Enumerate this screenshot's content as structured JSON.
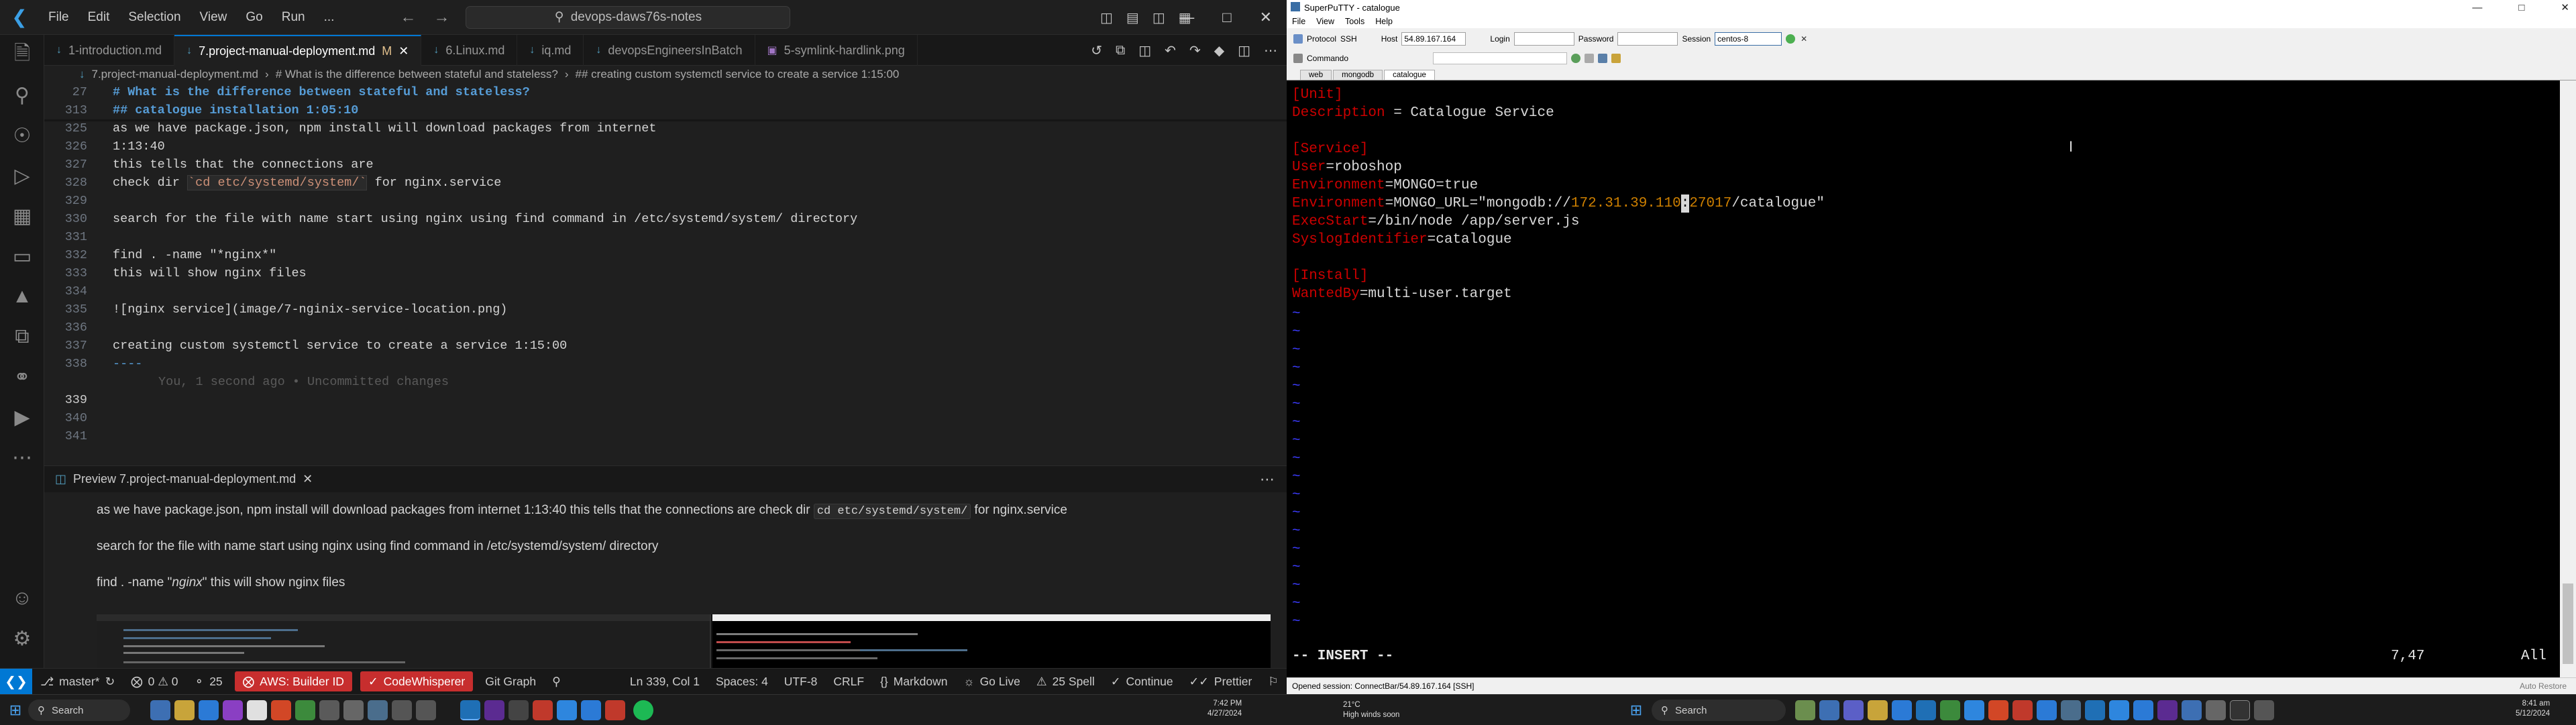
{
  "vscode": {
    "menu": [
      "File",
      "Edit",
      "Selection",
      "View",
      "Go",
      "Run",
      "..."
    ],
    "search_text": "devops-daws76s-notes",
    "tabs": [
      {
        "label": "1-introduction.md",
        "icon": "M",
        "active": false
      },
      {
        "label": "7.project-manual-deployment.md",
        "icon": "M",
        "mod": "M",
        "active": true
      },
      {
        "label": "6.Linux.md",
        "icon": "M",
        "active": false
      },
      {
        "label": "iq.md",
        "icon": "M",
        "active": false
      },
      {
        "label": "devopsEngineersInBatch",
        "icon": "M",
        "active": false
      },
      {
        "label": "5-symlink-hardlink.png",
        "icon": "img",
        "active": false
      }
    ],
    "breadcrumb": {
      "file": "7.project-manual-deployment.md",
      "h1": "# What is the difference between stateful and stateless?",
      "h2": "## creating custom systemctl service to create a service 1:15:00"
    },
    "code_lines": [
      {
        "n": "27",
        "text": "# What is the difference between stateful and stateless?",
        "kind": "heading",
        "sticky": true
      },
      {
        "n": "313",
        "text": "## catalogue installation 1:05:10",
        "kind": "heading",
        "sticky": true
      },
      {
        "n": "325",
        "text": "as we have package.json, npm install will download packages from internet",
        "kind": "text"
      },
      {
        "n": "326",
        "text": "1:13:40",
        "kind": "text"
      },
      {
        "n": "327",
        "text": "this tells that the connections are",
        "kind": "text"
      },
      {
        "n": "328",
        "pre": "check dir ",
        "code": "`cd etc/systemd/system/`",
        "post": " for nginx.service",
        "kind": "inline"
      },
      {
        "n": "329",
        "text": "",
        "kind": "text"
      },
      {
        "n": "330",
        "text": "search for the file with name start using nginx using find command in /etc/systemd/system/ directory",
        "kind": "text"
      },
      {
        "n": "331",
        "text": "",
        "kind": "text"
      },
      {
        "n": "332",
        "text": "find . -name \"*nginx*\"",
        "kind": "text"
      },
      {
        "n": "333",
        "text": "this will show nginx files",
        "kind": "text"
      },
      {
        "n": "334",
        "text": "",
        "kind": "text"
      },
      {
        "n": "335",
        "text": "![nginx service](image/7-nginix-service-location.png)",
        "kind": "text"
      },
      {
        "n": "336",
        "text": "",
        "kind": "text"
      },
      {
        "n": "337",
        "text": "creating custom systemctl service to create a service 1:15:00",
        "kind": "text"
      },
      {
        "n": "338",
        "text": "----",
        "kind": "hr"
      },
      {
        "n": "",
        "text": "You, 1 second ago • Uncommitted changes",
        "kind": "blame"
      },
      {
        "n": "339",
        "text": "",
        "kind": "current"
      },
      {
        "n": "340",
        "text": "",
        "kind": "text"
      },
      {
        "n": "341",
        "text": "",
        "kind": "text"
      }
    ],
    "preview_tab": "Preview 7.project-manual-deployment.md",
    "preview": {
      "p1_pre": "as we have package.json, npm install will download packages from internet 1:13:40 this tells that the connections are check dir",
      "p1_code": "cd etc/systemd/system/",
      "p1_post": "for nginx.service",
      "p2": "search for the file with name start using nginx using find command in /etc/systemd/system/ directory",
      "p3_pre": "find . -name \"",
      "p3_em": "nginx",
      "p3_post": "\" this will show nginx files"
    },
    "status": {
      "branch": "master*",
      "problems": "0 ⚠ 0",
      "ports": "25",
      "aws": "AWS: Builder ID",
      "codewhisperer": "CodeWhisperer",
      "git_graph": "Git Graph",
      "position": "Ln 339, Col 1",
      "spaces": "Spaces: 4",
      "encoding": "UTF-8",
      "eol": "CRLF",
      "language": "Markdown",
      "golive": "Go Live",
      "spell": "25 Spell",
      "continue": "Continue",
      "prettier": "Prettier"
    }
  },
  "putty": {
    "title": "SuperPuTTY - catalogue",
    "menu": [
      "File",
      "View",
      "Tools",
      "Help"
    ],
    "protocol_label": "Protocol",
    "protocol_value": "SSH",
    "host_label": "Host",
    "host_value": "54.89.167.164",
    "login_label": "Login",
    "password_label": "Password",
    "session_label": "Session",
    "session_value": "centos-8",
    "commands_label": "Commando",
    "tabs": [
      "web",
      "mongodb",
      "catalogue"
    ],
    "active_tab": "catalogue",
    "status_text": "Opened session: ConnectBar/54.89.167.164 [SSH]",
    "status_right": "Auto Restore",
    "vim_mode": "-- INSERT --",
    "vim_pos": "7,47",
    "vim_all": "All",
    "terminal_lines": [
      {
        "parts": [
          {
            "t": "[Unit]",
            "c": "tr"
          }
        ]
      },
      {
        "parts": [
          {
            "t": "Description",
            "c": "tr"
          },
          {
            "t": " = Catalogue Service",
            "c": "tw"
          }
        ]
      },
      {
        "parts": [
          {
            "t": "",
            "c": "tw"
          }
        ]
      },
      {
        "parts": [
          {
            "t": "[Service]",
            "c": "tr"
          }
        ]
      },
      {
        "parts": [
          {
            "t": "User",
            "c": "tr"
          },
          {
            "t": "=roboshop",
            "c": "tw"
          }
        ]
      },
      {
        "parts": [
          {
            "t": "Environment",
            "c": "tr"
          },
          {
            "t": "=MONGO=true",
            "c": "tw"
          }
        ]
      },
      {
        "parts": [
          {
            "t": "Environment",
            "c": "tr"
          },
          {
            "t": "=MONGO_URL=\"mongodb://",
            "c": "tw"
          },
          {
            "t": "172.31.39.110",
            "c": "tc"
          },
          {
            "t": ":",
            "c": "cur"
          },
          {
            "t": "27017",
            "c": "tc"
          },
          {
            "t": "/catalogue\"",
            "c": "tw"
          }
        ]
      },
      {
        "parts": [
          {
            "t": "ExecStart",
            "c": "tr"
          },
          {
            "t": "=/bin/node /app/server.js",
            "c": "tw"
          }
        ]
      },
      {
        "parts": [
          {
            "t": "SyslogIdentifier",
            "c": "tr"
          },
          {
            "t": "=catalogue",
            "c": "tw"
          }
        ]
      },
      {
        "parts": [
          {
            "t": "",
            "c": "tw"
          }
        ]
      },
      {
        "parts": [
          {
            "t": "[Install]",
            "c": "tr"
          }
        ]
      },
      {
        "parts": [
          {
            "t": "WantedBy",
            "c": "tr"
          },
          {
            "t": "=multi-user.target",
            "c": "tw"
          }
        ]
      }
    ]
  },
  "taskbar": {
    "search_left": "Search",
    "search_right": "Search",
    "time_left": "7:42 PM",
    "date_left": "4/27/2024",
    "weather_temp": "21°C",
    "weather_desc": "High winds soon",
    "time_right": "8:41 am",
    "date_right": "5/12/2024"
  }
}
